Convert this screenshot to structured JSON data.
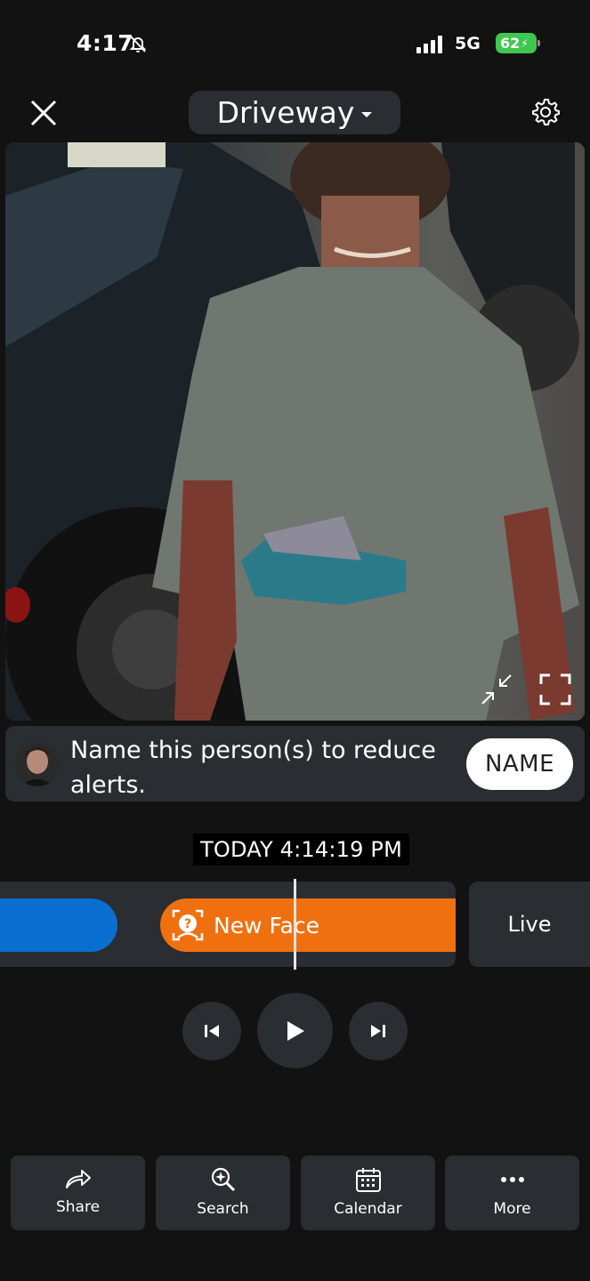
{
  "status_bar": {
    "time": "4:17",
    "network": "5G",
    "battery": "62"
  },
  "header": {
    "camera_name": "Driveway"
  },
  "prompt": {
    "message": "Name this person(s) to reduce alerts.",
    "button": "NAME"
  },
  "timestamp": "TODAY 4:14:19 PM",
  "timeline": {
    "event_label": "New Face",
    "live_label": "Live"
  },
  "toolbar": {
    "share": "Share",
    "search": "Search",
    "calendar": "Calendar",
    "more": "More"
  },
  "colors": {
    "background": "#121212",
    "surface": "#2a2d31",
    "event_orange": "#f07010",
    "event_blue": "#0a6fd1",
    "battery_green": "#3fc74f"
  },
  "icons": [
    "bell-slash-icon",
    "signal-icon",
    "battery-icon",
    "close-icon",
    "chevron-down-icon",
    "gear-icon",
    "minimize-icon",
    "fullscreen-icon",
    "face-question-icon",
    "skip-previous-icon",
    "play-icon",
    "skip-next-icon",
    "share-icon",
    "search-sparkle-icon",
    "calendar-icon",
    "more-icon"
  ]
}
